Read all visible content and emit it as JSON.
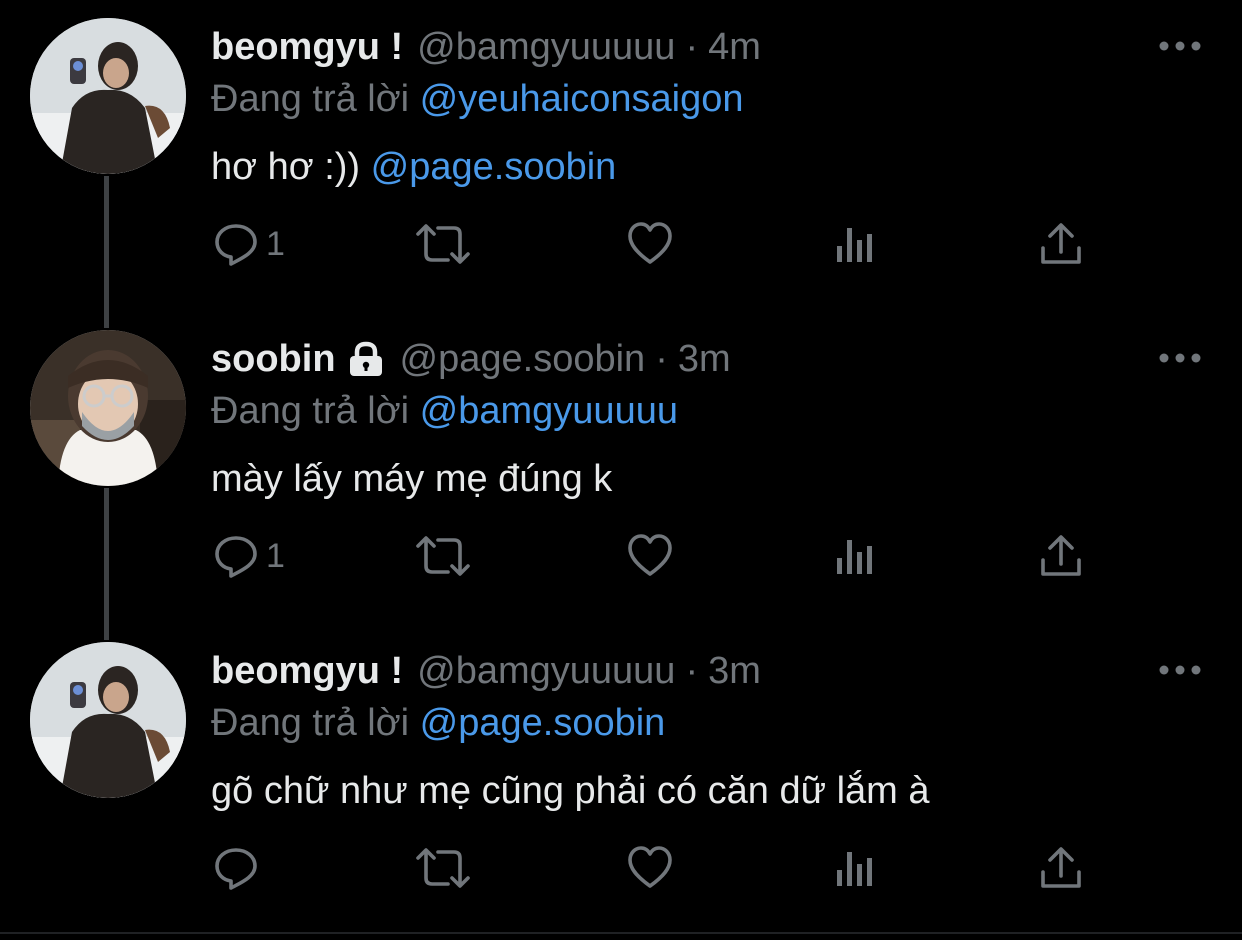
{
  "thread": [
    {
      "name": "beomgyu !",
      "handle": "@bamgyuuuuu",
      "separator": "·",
      "time": "4m",
      "locked": false,
      "reply_prefix": "Đang trả lời",
      "reply_to": "@yeuhaiconsaigon",
      "text": "hơ hơ :))",
      "text_mention": "@page.soobin",
      "reply_count": "1",
      "avatar_icon": "avatar-beomgyu"
    },
    {
      "name": "soobin",
      "handle": "@page.soobin",
      "separator": "·",
      "time": "3m",
      "locked": true,
      "reply_prefix": "Đang trả lời",
      "reply_to": "@bamgyuuuuu",
      "text": "mày lấy máy mẹ đúng k",
      "text_mention": "",
      "reply_count": "1",
      "avatar_icon": "avatar-soobin"
    },
    {
      "name": "beomgyu !",
      "handle": "@bamgyuuuuu",
      "separator": "·",
      "time": "3m",
      "locked": false,
      "reply_prefix": "Đang trả lời",
      "reply_to": "@page.soobin",
      "text": "gõ chữ như mẹ cũng phải có căn dữ lắm à",
      "text_mention": "",
      "reply_count": "",
      "avatar_icon": "avatar-beomgyu"
    }
  ],
  "icons": {
    "reply": "reply-icon",
    "retweet": "retweet-icon",
    "like": "like-icon",
    "views": "views-icon",
    "share": "share-icon",
    "more": "more-icon",
    "lock": "lock-icon"
  },
  "colors": {
    "background": "#000000",
    "text": "#e7e9ea",
    "muted": "#71767b",
    "link": "#4a99e9",
    "thread_line": "#3e4144"
  }
}
